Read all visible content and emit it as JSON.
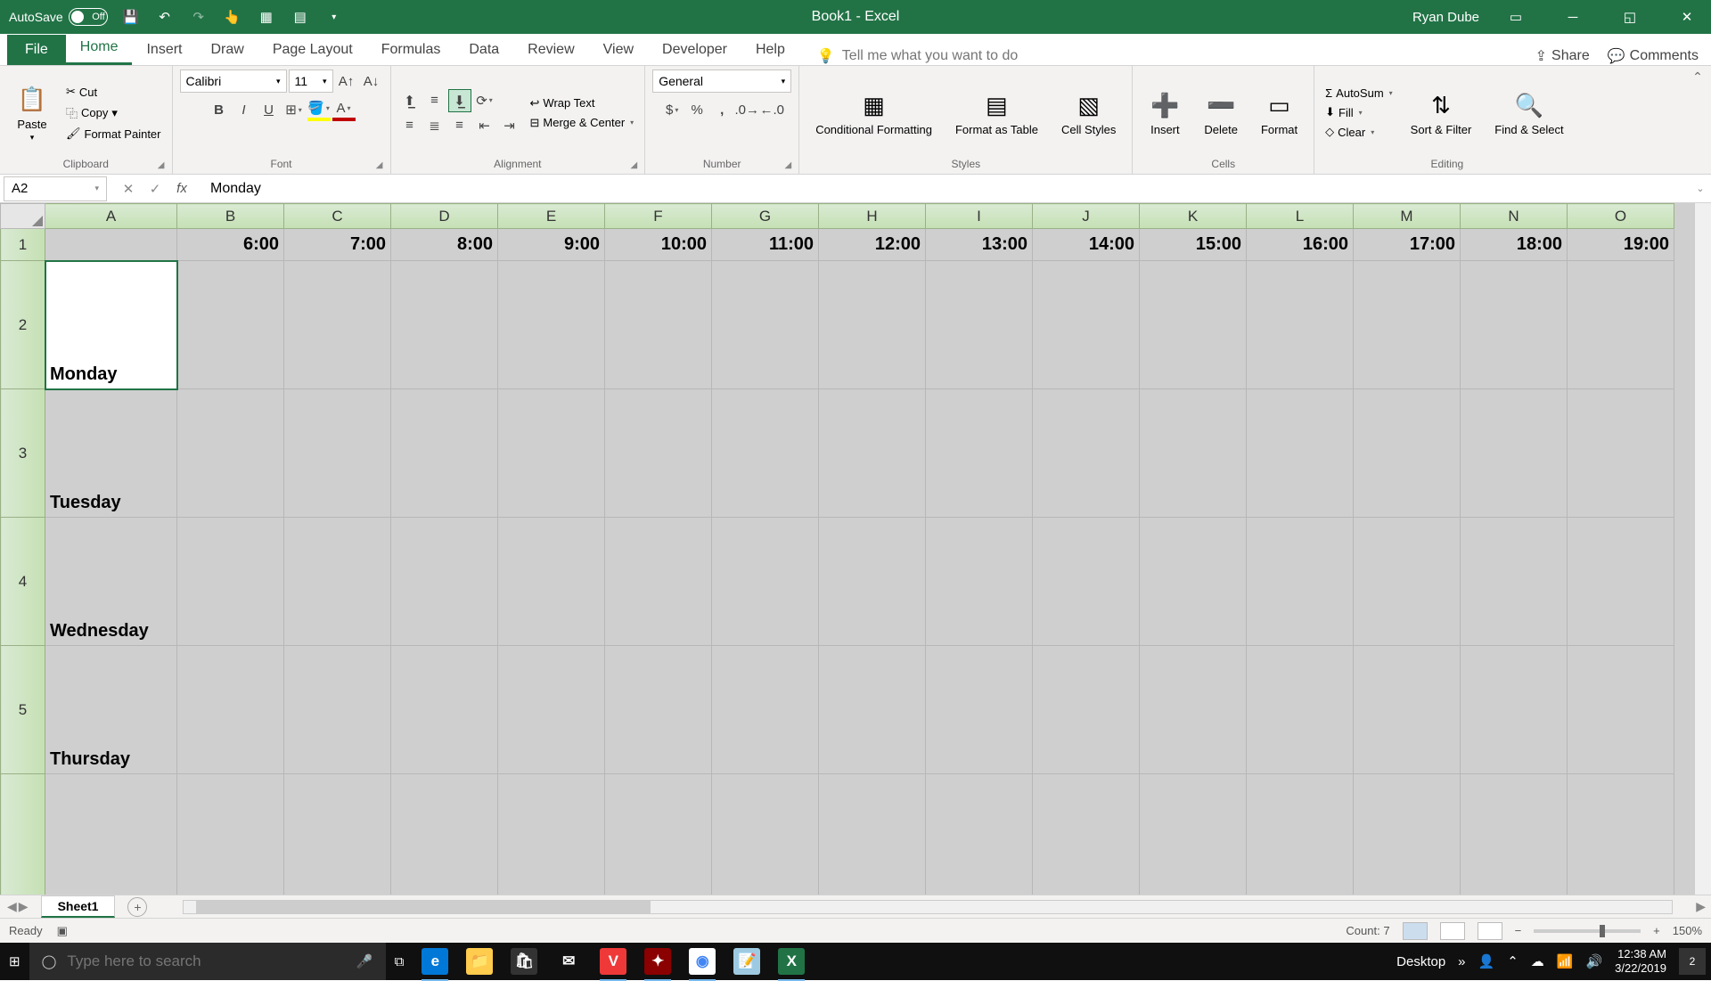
{
  "titlebar": {
    "autosave_label": "AutoSave",
    "autosave_state": "Off",
    "doc_title": "Book1 - Excel",
    "user": "Ryan Dube"
  },
  "tabs": {
    "file": "File",
    "list": [
      "Home",
      "Insert",
      "Draw",
      "Page Layout",
      "Formulas",
      "Data",
      "Review",
      "View",
      "Developer",
      "Help"
    ],
    "active": "Home",
    "tellme_placeholder": "Tell me what you want to do",
    "share": "Share",
    "comments": "Comments"
  },
  "ribbon": {
    "clipboard": {
      "label": "Clipboard",
      "paste": "Paste",
      "cut": "Cut",
      "copy": "Copy",
      "painter": "Format Painter"
    },
    "font": {
      "label": "Font",
      "name": "Calibri",
      "size": "11"
    },
    "alignment": {
      "label": "Alignment",
      "wrap": "Wrap Text",
      "merge": "Merge & Center"
    },
    "number": {
      "label": "Number",
      "format": "General"
    },
    "styles": {
      "label": "Styles",
      "cond": "Conditional Formatting",
      "table": "Format as Table",
      "cell": "Cell Styles"
    },
    "cells": {
      "label": "Cells",
      "insert": "Insert",
      "delete": "Delete",
      "format": "Format"
    },
    "editing": {
      "label": "Editing",
      "autosum": "AutoSum",
      "fill": "Fill",
      "clear": "Clear",
      "sort": "Sort & Filter",
      "find": "Find & Select"
    }
  },
  "fbar": {
    "namebox": "A2",
    "formula": "Monday"
  },
  "grid": {
    "columns": [
      "A",
      "B",
      "C",
      "D",
      "E",
      "F",
      "G",
      "H",
      "I",
      "J",
      "K",
      "L",
      "M",
      "N",
      "O"
    ],
    "row_numbers": [
      1,
      2,
      3,
      4,
      5
    ],
    "times": [
      "6:00",
      "7:00",
      "8:00",
      "9:00",
      "10:00",
      "11:00",
      "12:00",
      "13:00",
      "14:00",
      "15:00",
      "16:00",
      "17:00",
      "18:00",
      "19:00"
    ],
    "days": [
      "Monday",
      "Tuesday",
      "Wednesday",
      "Thursday"
    ],
    "active_cell": "A2"
  },
  "sheets": {
    "active": "Sheet1"
  },
  "status": {
    "ready": "Ready",
    "count": "Count: 7",
    "zoom": "150%"
  },
  "taskbar": {
    "search_placeholder": "Type here to search",
    "desktop": "Desktop",
    "time": "12:38 AM",
    "date": "3/22/2019",
    "notif": "2"
  },
  "chart_data": {
    "type": "table",
    "note": "Weekly schedule grid: columns are hours 6:00–19:00, rows are weekdays. All data cells empty in screenshot.",
    "columns": [
      "",
      "6:00",
      "7:00",
      "8:00",
      "9:00",
      "10:00",
      "11:00",
      "12:00",
      "13:00",
      "14:00",
      "15:00",
      "16:00",
      "17:00",
      "18:00",
      "19:00"
    ],
    "rows": [
      {
        "day": "Monday",
        "values": [
          "",
          "",
          "",
          "",
          "",
          "",
          "",
          "",
          "",
          "",
          "",
          "",
          "",
          ""
        ]
      },
      {
        "day": "Tuesday",
        "values": [
          "",
          "",
          "",
          "",
          "",
          "",
          "",
          "",
          "",
          "",
          "",
          "",
          "",
          ""
        ]
      },
      {
        "day": "Wednesday",
        "values": [
          "",
          "",
          "",
          "",
          "",
          "",
          "",
          "",
          "",
          "",
          "",
          "",
          "",
          ""
        ]
      },
      {
        "day": "Thursday",
        "values": [
          "",
          "",
          "",
          "",
          "",
          "",
          "",
          "",
          "",
          "",
          "",
          "",
          "",
          ""
        ]
      }
    ]
  }
}
